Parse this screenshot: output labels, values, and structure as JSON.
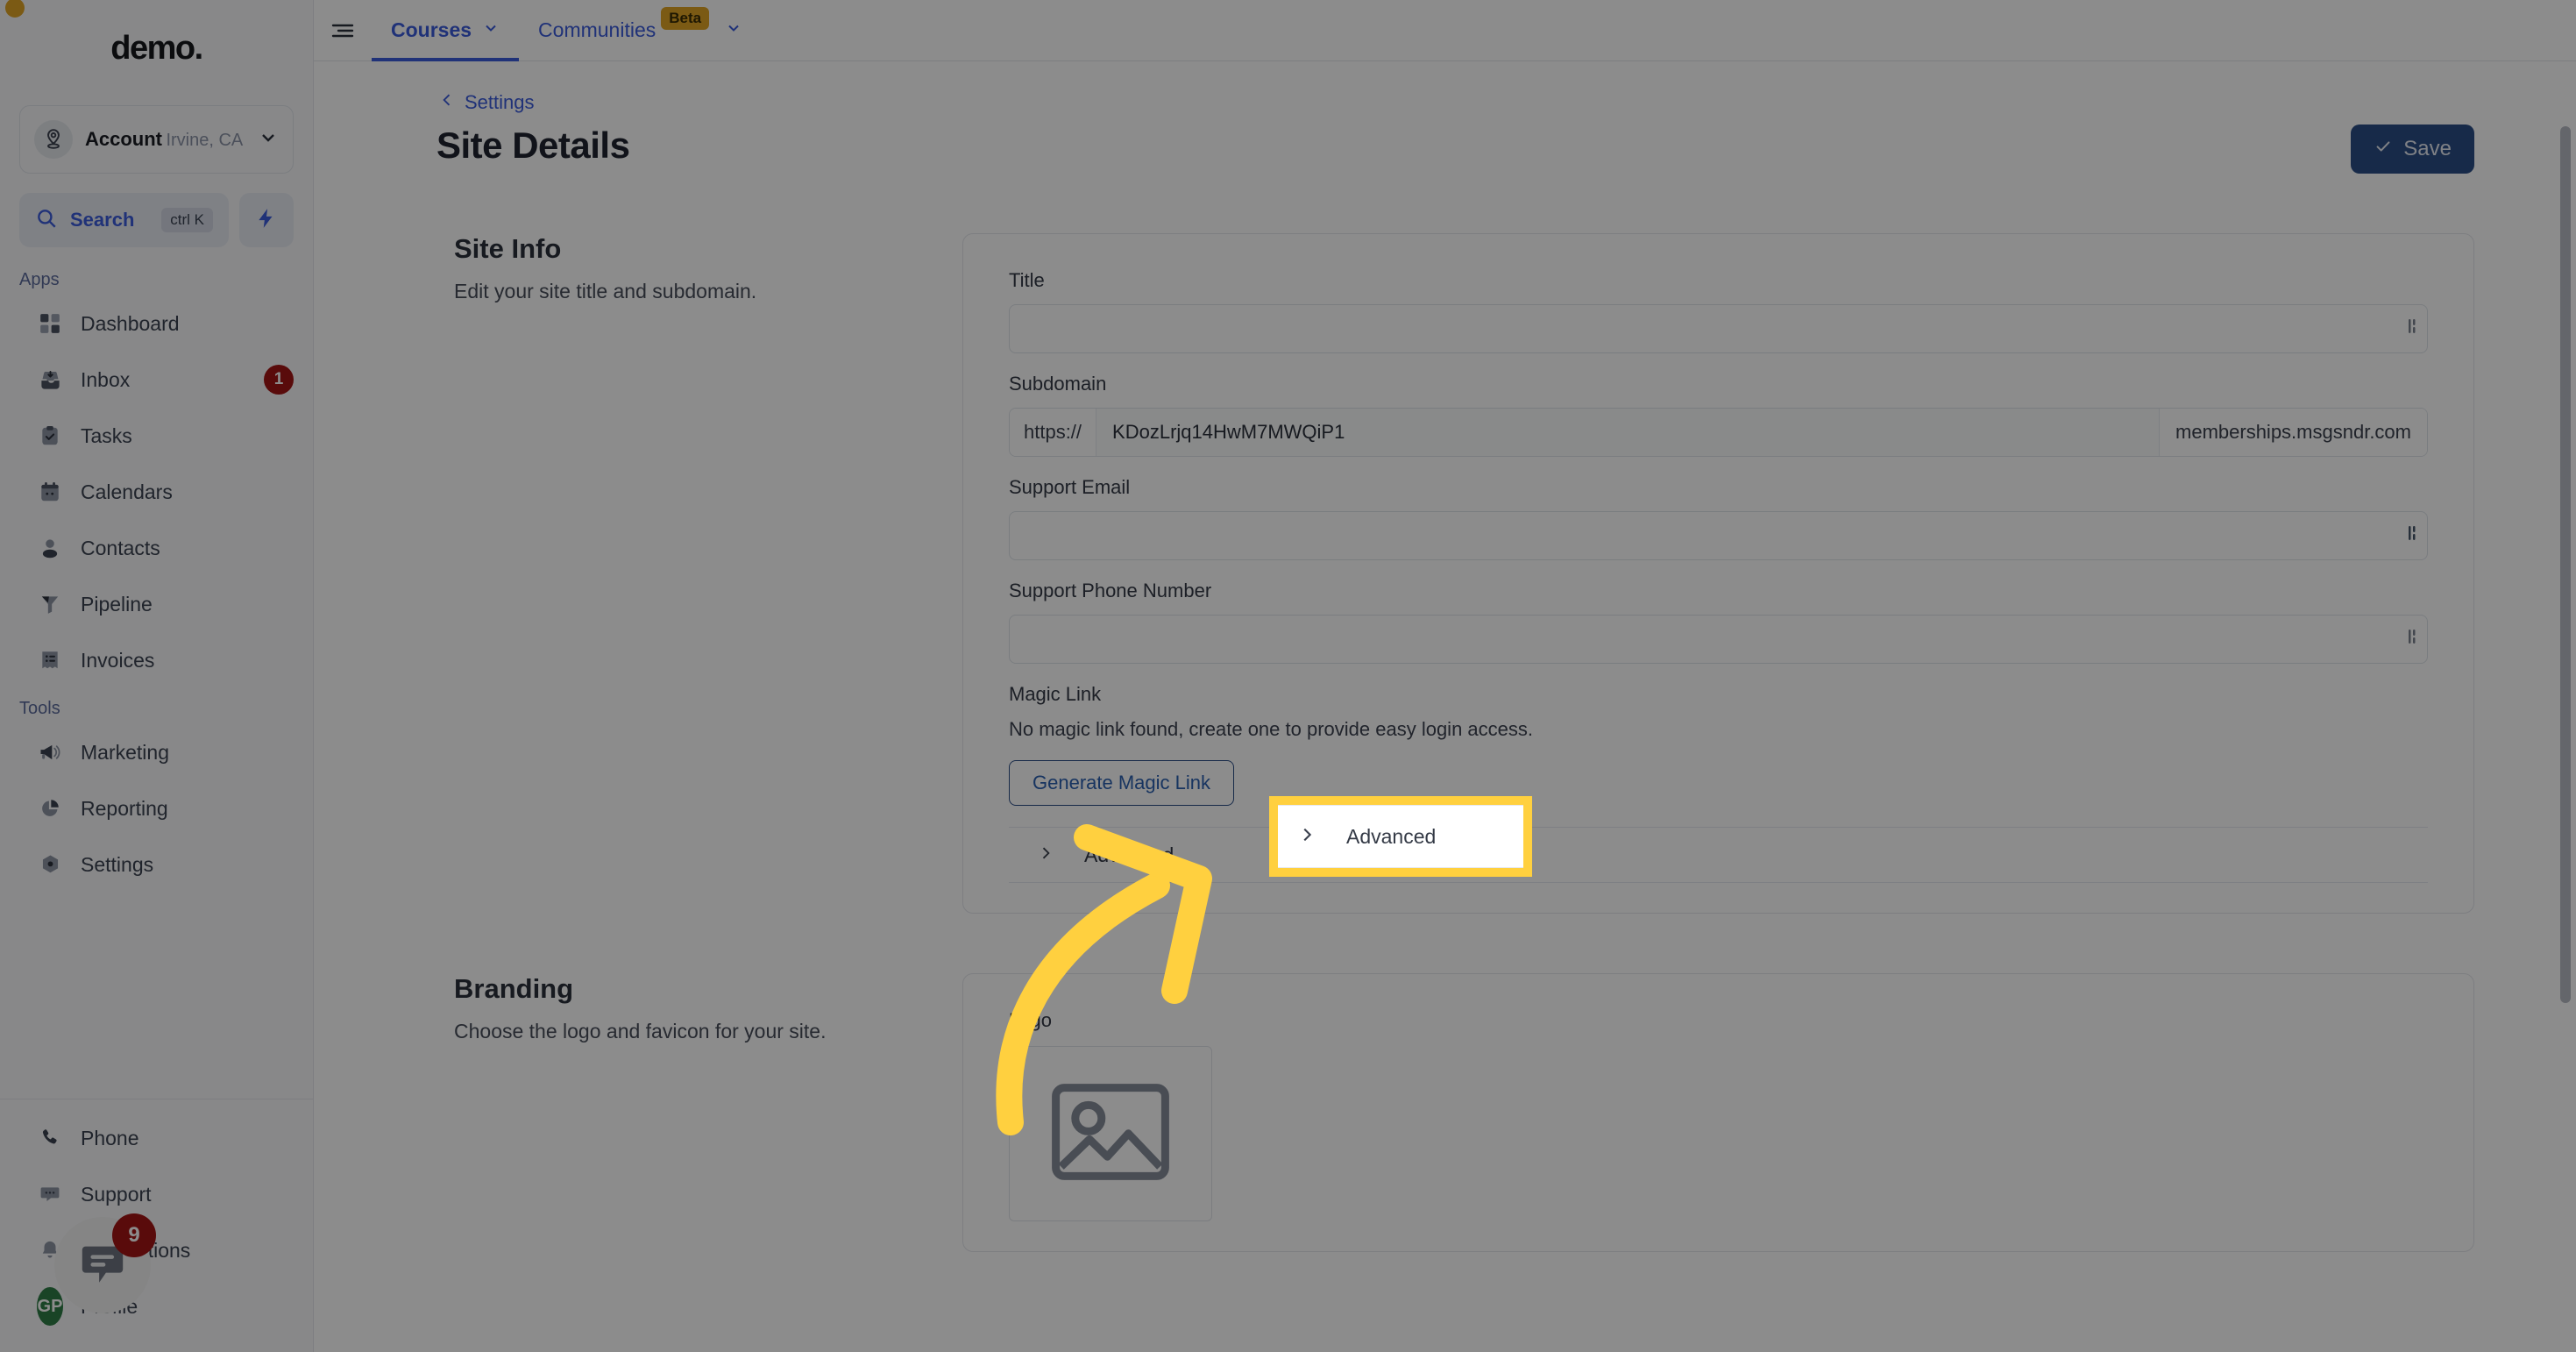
{
  "sidebar": {
    "brand": "demo",
    "brand_dot": ".",
    "account": {
      "name": "Account",
      "location": "Irvine, CA",
      "avatar_icon": "location-pin-icon",
      "chevron_icon": "chevron-down-icon"
    },
    "search": {
      "label": "Search",
      "shortcut": "ctrl K",
      "icon": "search-icon"
    },
    "quick_action_icon": "lightning-bolt-icon",
    "sections": [
      {
        "label": "Apps",
        "items": [
          {
            "label": "Dashboard",
            "icon": "dashboard-grid-icon",
            "badge": ""
          },
          {
            "label": "Inbox",
            "icon": "inbox-icon",
            "badge": "1"
          },
          {
            "label": "Tasks",
            "icon": "clipboard-check-icon",
            "badge": ""
          },
          {
            "label": "Calendars",
            "icon": "calendar-icon",
            "badge": ""
          },
          {
            "label": "Contacts",
            "icon": "person-icon",
            "badge": ""
          },
          {
            "label": "Pipeline",
            "icon": "funnel-icon",
            "badge": ""
          },
          {
            "label": "Invoices",
            "icon": "invoice-list-icon",
            "badge": ""
          }
        ]
      },
      {
        "label": "Tools",
        "items": [
          {
            "label": "Marketing",
            "icon": "megaphone-icon",
            "badge": ""
          },
          {
            "label": "Reporting",
            "icon": "pie-chart-icon",
            "badge": ""
          },
          {
            "label": "Settings",
            "icon": "gear-hexagon-icon",
            "badge": ""
          }
        ]
      }
    ],
    "bottom_items": [
      {
        "label": "Phone",
        "icon": "phone-icon",
        "badge": ""
      },
      {
        "label": "Support",
        "icon": "chat-dots-icon",
        "badge": ""
      },
      {
        "label": "Notifications",
        "icon": "bell-icon",
        "badge": ""
      },
      {
        "label": "Profile",
        "icon": "avatar-icon",
        "badge": "",
        "avatar_initials": "GP"
      }
    ],
    "chat_widget": {
      "badge": "9",
      "icon": "chat-bubble-icon"
    }
  },
  "topbar": {
    "menu_icon": "hamburger-menu-icon",
    "tabs": [
      {
        "label": "Courses",
        "active": true,
        "chevron_icon": "chevron-down-icon",
        "badge": ""
      },
      {
        "label": "Communities",
        "active": false,
        "chevron_icon": "chevron-down-icon",
        "badge": "Beta"
      }
    ]
  },
  "page": {
    "breadcrumb": "Settings",
    "breadcrumb_icon": "chevron-left-icon",
    "title": "Site Details",
    "save_label": "Save",
    "save_icon": "check-icon"
  },
  "site_info": {
    "heading": "Site Info",
    "description": "Edit your site title and subdomain.",
    "fields": {
      "title": {
        "label": "Title",
        "value": "",
        "placeholder": ""
      },
      "subdomain": {
        "label": "Subdomain",
        "prefix": "https://",
        "value": "KDozLrjq14HwM7MWQiP1",
        "suffix": "memberships.msgsndr.com"
      },
      "support_email": {
        "label": "Support Email",
        "value": "",
        "placeholder": ""
      },
      "support_phone": {
        "label": "Support Phone Number",
        "value": "",
        "placeholder": ""
      }
    },
    "magic_link": {
      "label": "Magic Link",
      "description": "No magic link found, create one to provide easy login access.",
      "button_label": "Generate Magic Link"
    },
    "advanced": {
      "label": "Advanced",
      "chevron_icon": "chevron-right-icon"
    }
  },
  "branding": {
    "heading": "Branding",
    "description": "Choose the logo and favicon for your site.",
    "logo_label": "Logo",
    "logo_placeholder_icon": "image-placeholder-icon"
  },
  "annotation": {
    "arrow_icon": "curved-arrow-icon",
    "highlight_color": "#FFD03F",
    "target": "Advanced"
  },
  "colors": {
    "accent_blue": "#3b5bdb",
    "save_blue": "#2b4d86",
    "badge_red": "#a31515",
    "beta_yellow": "#e0a526",
    "highlight_yellow": "#FFD03F",
    "avatar_green": "#2f7d46"
  }
}
